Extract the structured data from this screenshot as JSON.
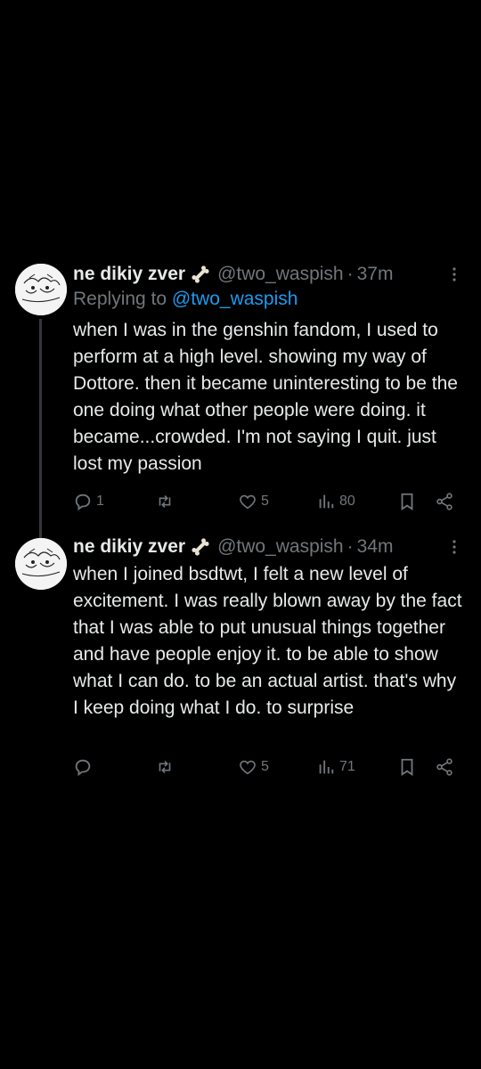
{
  "tweets": [
    {
      "name": "ne dikiy zver",
      "handle": "@two_waspish",
      "dot": "·",
      "time": "37m",
      "reply_prefix": "Replying to ",
      "reply_handle": "@two_waspish",
      "text": "when I was in the genshin fandom, I used to perform at a high level. showing my way of Dottore. then it became uninteresting to be the one doing what other people were doing. it became...crowded. I'm not saying I quit. just lost my passion",
      "replies": "1",
      "retweets": "",
      "likes": "5",
      "views": "80"
    },
    {
      "name": "ne dikiy zver",
      "handle": "@two_waspish",
      "dot": "·",
      "time": "34m",
      "text": "when I joined bsdtwt, I felt a new level of excitement. I was really blown away by the fact that I was able to put unusual things together and have people enjoy it. to be able to show what I can do. to be an actual artist. that's why I keep doing what I do. to surprise",
      "replies": "",
      "retweets": "",
      "likes": "5",
      "views": "71"
    }
  ],
  "icons": {
    "name_emoji": "bone-icon",
    "more": "more-vertical-icon",
    "reply": "reply-icon",
    "retweet": "retweet-icon",
    "like": "heart-icon",
    "views": "views-bar-chart-icon",
    "bookmark": "bookmark-icon",
    "share": "share-icon"
  },
  "colors": {
    "background": "#000000",
    "text": "#e7e9ea",
    "muted": "#71767b",
    "link": "#1d9bf0",
    "thread_line": "#333639"
  }
}
